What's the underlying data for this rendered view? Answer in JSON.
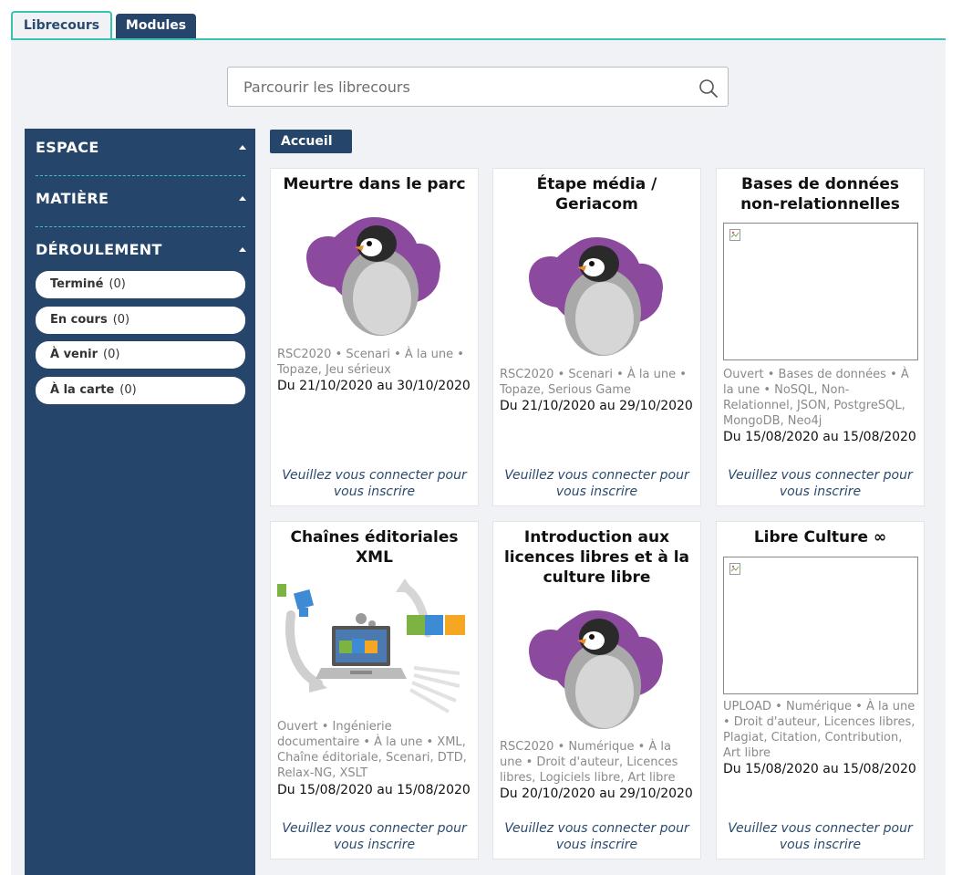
{
  "tabs": [
    {
      "label": "Librecours"
    },
    {
      "label": "Modules"
    }
  ],
  "search": {
    "placeholder": "Parcourir les librecours"
  },
  "sidebar": {
    "sections": [
      {
        "title": "ESPACE"
      },
      {
        "title": "MATIÈRE"
      },
      {
        "title": "DÉROULEMENT"
      }
    ],
    "filters": [
      {
        "label": "Terminé",
        "count": "(0)"
      },
      {
        "label": "En cours",
        "count": "(0)"
      },
      {
        "label": "À venir",
        "count": "(0)"
      },
      {
        "label": "À la carte",
        "count": "(0)"
      }
    ]
  },
  "breadcrumb": {
    "label": "Accueil"
  },
  "cards": [
    {
      "title": "Meurtre dans le parc",
      "image": "penguin-icon",
      "tags": "RSC2020 • Scenari • À la une • Topaze, Jeu sérieux",
      "dates": "Du 21/10/2020 au 30/10/2020",
      "login": "Veuillez vous connecter pour vous inscrire"
    },
    {
      "title": "Étape média / Geriacom",
      "image": "penguin-icon",
      "tags": "RSC2020 • Scenari • À la une • Topaze, Serious Game",
      "dates": "Du 21/10/2020 au 29/10/2020",
      "login": "Veuillez vous connecter pour vous inscrire"
    },
    {
      "title": "Bases de données non-relationnelles",
      "image": "broken-image-icon",
      "tags": "Ouvert • Bases de données • À la une • NoSQL, Non-Relationnel, JSON, PostgreSQL, MongoDB, Neo4j",
      "dates": "Du 15/08/2020 au 15/08/2020",
      "login": "Veuillez vous connecter pour vous inscrire"
    },
    {
      "title": "Chaînes éditoriales XML",
      "image": "laptop-puzzle-icon",
      "tags": "Ouvert • Ingénierie documentaire • À la une • XML, Chaîne éditoriale, Scenari, DTD, Relax-NG, XSLT",
      "dates": "Du 15/08/2020 au 15/08/2020",
      "login": "Veuillez vous connecter pour vous inscrire"
    },
    {
      "title": "Introduction aux licences libres et à la culture libre",
      "image": "penguin-icon",
      "tags": "RSC2020 • Numérique • À la une • Droit d'auteur, Licences libres, Logiciels libre, Art libre",
      "dates": "Du 20/10/2020 au 29/10/2020",
      "login": "Veuillez vous connecter pour vous inscrire"
    },
    {
      "title": "Libre Culture ∞",
      "image": "broken-image-icon",
      "tags": "UPLOAD • Numérique • À la une • Droit d'auteur, Licences libres, Plagiat, Citation, Contribution, Art libre",
      "dates": "Du 15/08/2020 au 15/08/2020",
      "login": "Veuillez vous connecter pour vous inscrire"
    }
  ]
}
